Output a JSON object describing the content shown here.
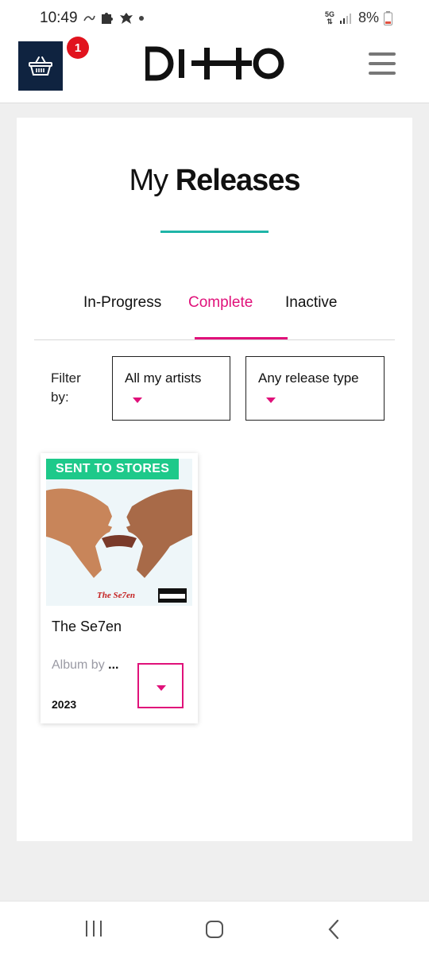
{
  "status_bar": {
    "time": "10:49",
    "network": "5G",
    "battery": "8%"
  },
  "header": {
    "cart_badge": "1",
    "logo_text": "DITTO",
    "colors": {
      "navy": "#0f2340",
      "badge": "#e1131e"
    }
  },
  "page": {
    "title_light": "My",
    "title_bold": "Releases",
    "accent": "#1fb5a8"
  },
  "tabs": [
    {
      "label": "In-Progress",
      "active": false
    },
    {
      "label": "Complete",
      "active": true
    },
    {
      "label": "Inactive",
      "active": false
    }
  ],
  "filter": {
    "label": "Filter by:",
    "artist_value": "All my artists",
    "type_value": "Any release type",
    "accent": "#e0117a"
  },
  "releases": [
    {
      "status": "SENT TO STORES",
      "title": "The Se7en",
      "by_prefix": "Album by",
      "by_artist": "...",
      "year": "2023",
      "status_color": "#1ec98a"
    }
  ]
}
